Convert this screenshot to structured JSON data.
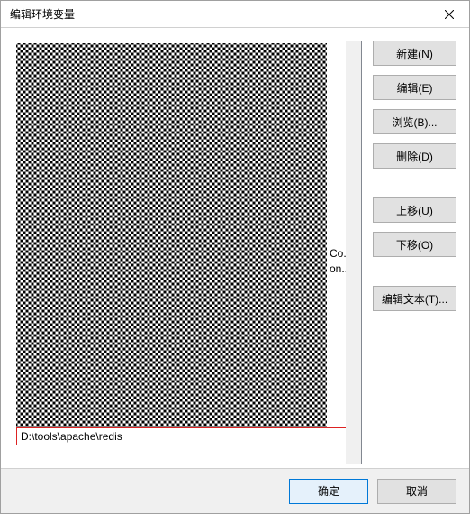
{
  "dialog": {
    "title": "编辑环境变量"
  },
  "list": {
    "peek1": "Co...",
    "peek2": "on...",
    "edit_value": "D:\\tools\\apache\\redis"
  },
  "buttons": {
    "new": "新建(N)",
    "edit": "编辑(E)",
    "browse": "浏览(B)...",
    "delete": "删除(D)",
    "move_up": "上移(U)",
    "move_down": "下移(O)",
    "edit_text": "编辑文本(T)..."
  },
  "footer": {
    "ok": "确定",
    "cancel": "取消"
  }
}
